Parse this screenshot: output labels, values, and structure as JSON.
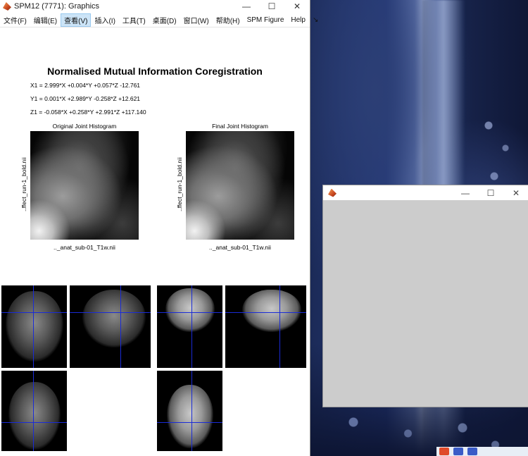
{
  "spm_window": {
    "title": "SPM12 (7771): Graphics",
    "controls": {
      "minimize": "—",
      "maximize": "☐",
      "close": "✕"
    },
    "menu": [
      "文件(F)",
      "编辑(E)",
      "查看(V)",
      "插入(I)",
      "工具(T)",
      "桌面(D)",
      "窗口(W)",
      "帮助(H)",
      "SPM Figure",
      "Help",
      "↘"
    ],
    "active_menu_index": 2
  },
  "figure": {
    "heading": "Normalised Mutual Information Coregistration",
    "equations": [
      "X1 = 2.999*X +0.004*Y +0.057*Z -12.761",
      "Y1 = 0.001*X +2.989*Y -0.258*Z +12.621",
      "Z1 = -0.058*X +0.258*Y +2.991*Z +117.140"
    ],
    "histograms": [
      {
        "title": "Original Joint Histogram",
        "ylabel": "..ffect_run-1_bold.nii",
        "xlabel": ".._anat_sub-01_T1w.nii"
      },
      {
        "title": "Final Joint Histogram",
        "ylabel": "..ffect_run-1_bold.nii",
        "xlabel": ".._anat_sub-01_T1w.nii"
      }
    ]
  },
  "blank_figure_window": {
    "title": "",
    "controls": {
      "minimize": "—",
      "maximize": "☐",
      "close": "✕"
    }
  },
  "colors": {
    "crosshair": "#1a2bd6",
    "menu_active_bg": "#cce4f7",
    "figure_bg": "#cccccc"
  }
}
